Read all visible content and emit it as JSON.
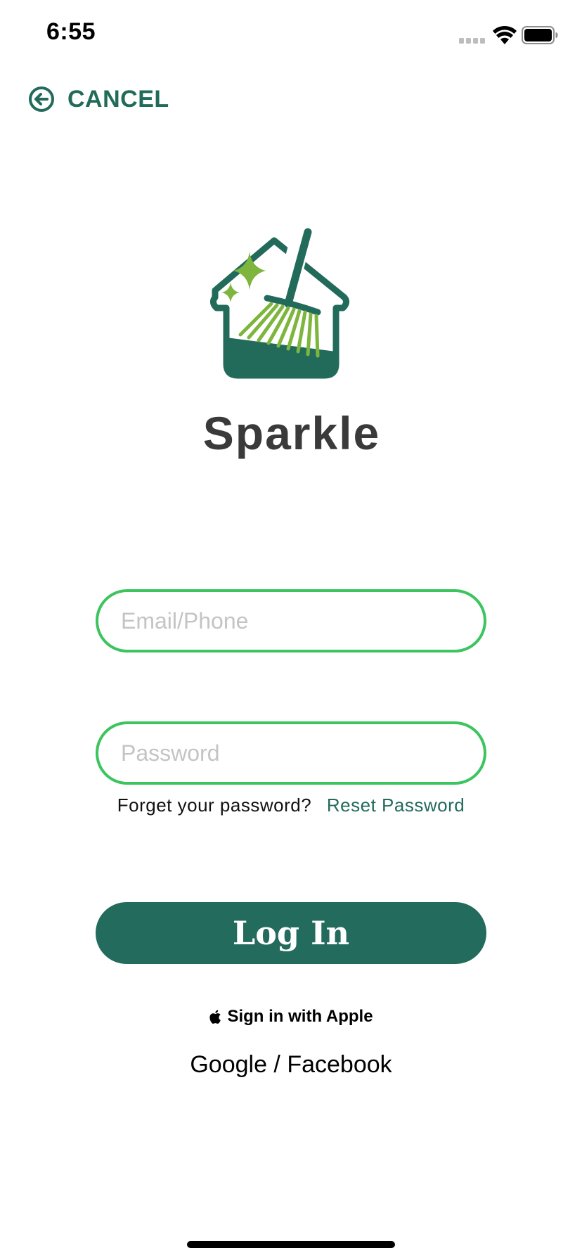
{
  "status_bar": {
    "time": "6:55",
    "icons": [
      "cellular-signal-icon",
      "wifi-icon",
      "battery-icon"
    ]
  },
  "nav": {
    "cancel_label": "CANCEL",
    "cancel_icon": "arrow-left-circle-icon"
  },
  "brand": {
    "name": "Sparkle",
    "logo_icon": "house-broom-sparkle-logo"
  },
  "form": {
    "email_placeholder": "Email/Phone",
    "email_value": "",
    "password_placeholder": "Password",
    "password_value": "",
    "forgot_text": "Forget your password?",
    "reset_link": "Reset Password",
    "login_label": "Log In"
  },
  "alt_signin": {
    "apple_label": "Sign in with Apple",
    "apple_icon": "apple-logo-icon",
    "social_label": "Google / Facebook"
  },
  "colors": {
    "primary": "#236b5c",
    "field_border": "#3cc45f",
    "accent_green": "#7db53d",
    "text_dark": "#3a3a3a"
  }
}
